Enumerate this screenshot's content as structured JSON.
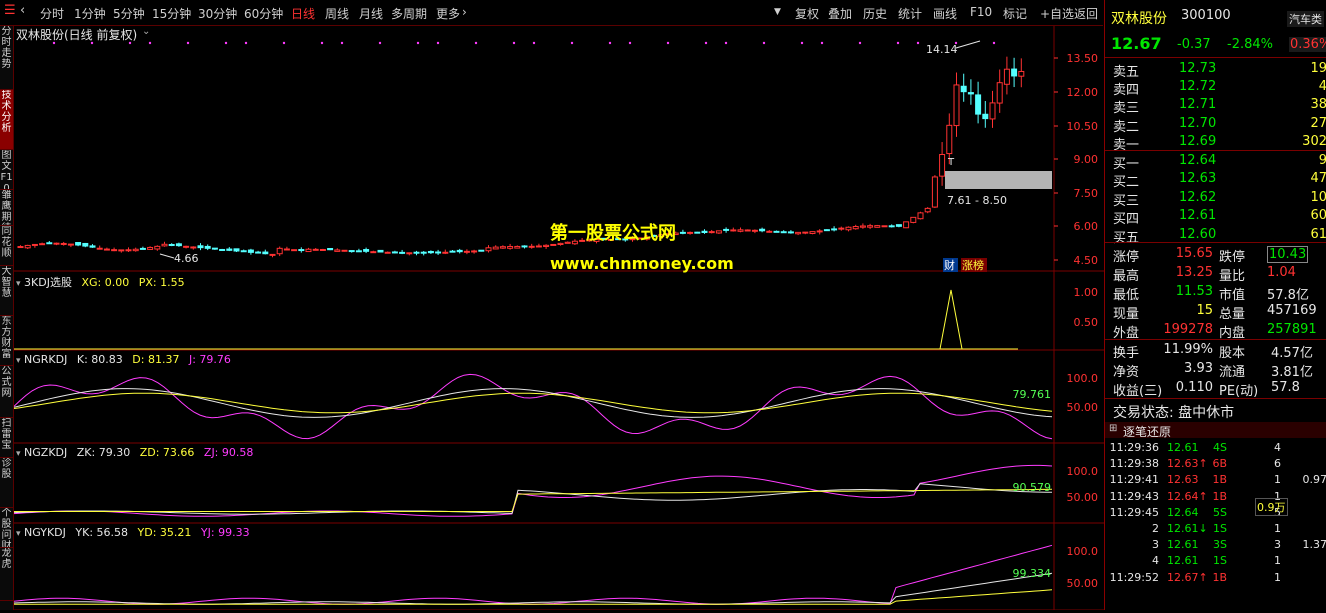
{
  "toolbar": {
    "periods": [
      "分时",
      "1分钟",
      "5分钟",
      "15分钟",
      "30分钟",
      "60分钟",
      "日线",
      "周线",
      "月线",
      "多周期",
      "更多"
    ],
    "active_period": "日线",
    "actions": [
      "复权",
      "叠加",
      "历史",
      "统计",
      "画线",
      "F10",
      "标记",
      "+自选",
      "返回"
    ]
  },
  "left_nav": [
    "分时走势",
    "技术分析",
    "图文F10",
    "雏鹰期待",
    "同花顺",
    "大智慧",
    "东方财富",
    "公式网",
    "扫雷宝",
    "诊股",
    "个股问财",
    "龙虎"
  ],
  "chart": {
    "title": "双林股份(日线 前复权)",
    "price_axis": [
      "13.50",
      "12.00",
      "10.50",
      "9.00",
      "7.50",
      "6.00",
      "4.50"
    ],
    "high_label": "14.14",
    "low_label": "4.66",
    "range_label": "7.61 - 8.50",
    "markers": [
      "T",
      "财",
      "涨榜"
    ],
    "watermark1": "第一股票公式网",
    "watermark2": "www.chnmoney.com",
    "panels": [
      {
        "name": "3KDJ选股",
        "items": [
          {
            "label": "XG: 0.00",
            "color": "#ffff3c"
          },
          {
            "label": "PX: 1.55",
            "color": "#ffff3c"
          }
        ],
        "axis": [
          "1.00",
          "0.50"
        ],
        "last": ""
      },
      {
        "name": "NGRKDJ",
        "items": [
          {
            "label": "K: 80.83",
            "color": "#e6e6e6"
          },
          {
            "label": "D: 81.37",
            "color": "#ffff3c"
          },
          {
            "label": "J: 79.76",
            "color": "#ff3cff"
          }
        ],
        "axis": [
          "100.0",
          "50.00"
        ],
        "last": "79.761"
      },
      {
        "name": "NGZKDJ",
        "items": [
          {
            "label": "ZK: 79.30",
            "color": "#e6e6e6"
          },
          {
            "label": "ZD: 73.66",
            "color": "#ffff3c"
          },
          {
            "label": "ZJ: 90.58",
            "color": "#ff3cff"
          }
        ],
        "axis": [
          "100.0",
          "50.00"
        ],
        "last": "90.579"
      },
      {
        "name": "NGYKDJ",
        "items": [
          {
            "label": "YK: 56.58",
            "color": "#e6e6e6"
          },
          {
            "label": "YD: 35.21",
            "color": "#ffff3c"
          },
          {
            "label": "YJ: 99.33",
            "color": "#ff3cff"
          }
        ],
        "axis": [
          "100.0",
          "50.00"
        ],
        "last": "99.334"
      }
    ]
  },
  "quote": {
    "name": "双林股份",
    "code": "300100",
    "sector": "汽车类",
    "sector_pct": "0.36%",
    "price": "12.67",
    "change": "-0.37",
    "change_pct": "-2.84%",
    "asks": [
      {
        "label": "卖五",
        "price": "12.73",
        "vol": "19"
      },
      {
        "label": "卖四",
        "price": "12.72",
        "vol": "4"
      },
      {
        "label": "卖三",
        "price": "12.71",
        "vol": "38"
      },
      {
        "label": "卖二",
        "price": "12.70",
        "vol": "27"
      },
      {
        "label": "卖一",
        "price": "12.69",
        "vol": "302"
      }
    ],
    "bids": [
      {
        "label": "买一",
        "price": "12.64",
        "vol": "9"
      },
      {
        "label": "买二",
        "price": "12.63",
        "vol": "47"
      },
      {
        "label": "买三",
        "price": "12.62",
        "vol": "10"
      },
      {
        "label": "买四",
        "price": "12.61",
        "vol": "60"
      },
      {
        "label": "买五",
        "price": "12.60",
        "vol": "61"
      }
    ],
    "stats1": [
      {
        "l1": "涨停",
        "v1": "15.65",
        "c1": "red",
        "l2": "跌停",
        "v2": "10.43",
        "c2": "green"
      },
      {
        "l1": "最高",
        "v1": "13.25",
        "c1": "red",
        "l2": "量比",
        "v2": "1.04",
        "c2": "red"
      },
      {
        "l1": "最低",
        "v1": "11.53",
        "c1": "green",
        "l2": "市值",
        "v2": "57.8亿",
        "c2": "white"
      },
      {
        "l1": "现量",
        "v1": "15",
        "c1": "yellow",
        "l2": "总量",
        "v2": "457169",
        "c2": "white"
      },
      {
        "l1": "外盘",
        "v1": "199278",
        "c1": "red",
        "l2": "内盘",
        "v2": "257891",
        "c2": "green"
      }
    ],
    "stats2": [
      {
        "l1": "换手",
        "v1": "11.99%",
        "l2": "股本",
        "v2": "4.57亿"
      },
      {
        "l1": "净资",
        "v1": "3.93",
        "l2": "流通",
        "v2": "3.81亿"
      },
      {
        "l1": "收益(三)",
        "v1": "0.110",
        "l2": "PE(动)",
        "v2": "57.8"
      }
    ],
    "trade_status": "交易状态: 盘中休市",
    "ticks_title": "逐笔还原",
    "ticks": [
      {
        "time": "11:29:36",
        "price": "12.61",
        "vol": "4S",
        "c": "green",
        "n": "4",
        "extra": ""
      },
      {
        "time": "11:29:38",
        "price": "12.63↑",
        "vol": "6B",
        "c": "red",
        "n": "6",
        "extra": ""
      },
      {
        "time": "11:29:41",
        "price": "12.63",
        "vol": "1B",
        "c": "red",
        "n": "1",
        "extra": "0.97"
      },
      {
        "time": "11:29:43",
        "price": "12.64↑",
        "vol": "1B",
        "c": "red",
        "n": "1",
        "extra": ""
      },
      {
        "time": "11:29:45",
        "price": "12.64",
        "vol": "5S",
        "c": "green",
        "n": "5",
        "extra": ""
      },
      {
        "time": "2",
        "price": "12.61↓",
        "vol": "1S",
        "c": "green",
        "n": "1",
        "extra": ""
      },
      {
        "time": "3",
        "price": "12.61",
        "vol": "3S",
        "c": "green",
        "n": "3",
        "extra": "1.37"
      },
      {
        "time": "4",
        "price": "12.61",
        "vol": "1S",
        "c": "green",
        "n": "1",
        "extra": ""
      },
      {
        "time": "11:29:52",
        "price": "12.67↑",
        "vol": "1B",
        "c": "red",
        "n": "1",
        "extra": ""
      }
    ],
    "tick_note": "0.9万"
  }
}
